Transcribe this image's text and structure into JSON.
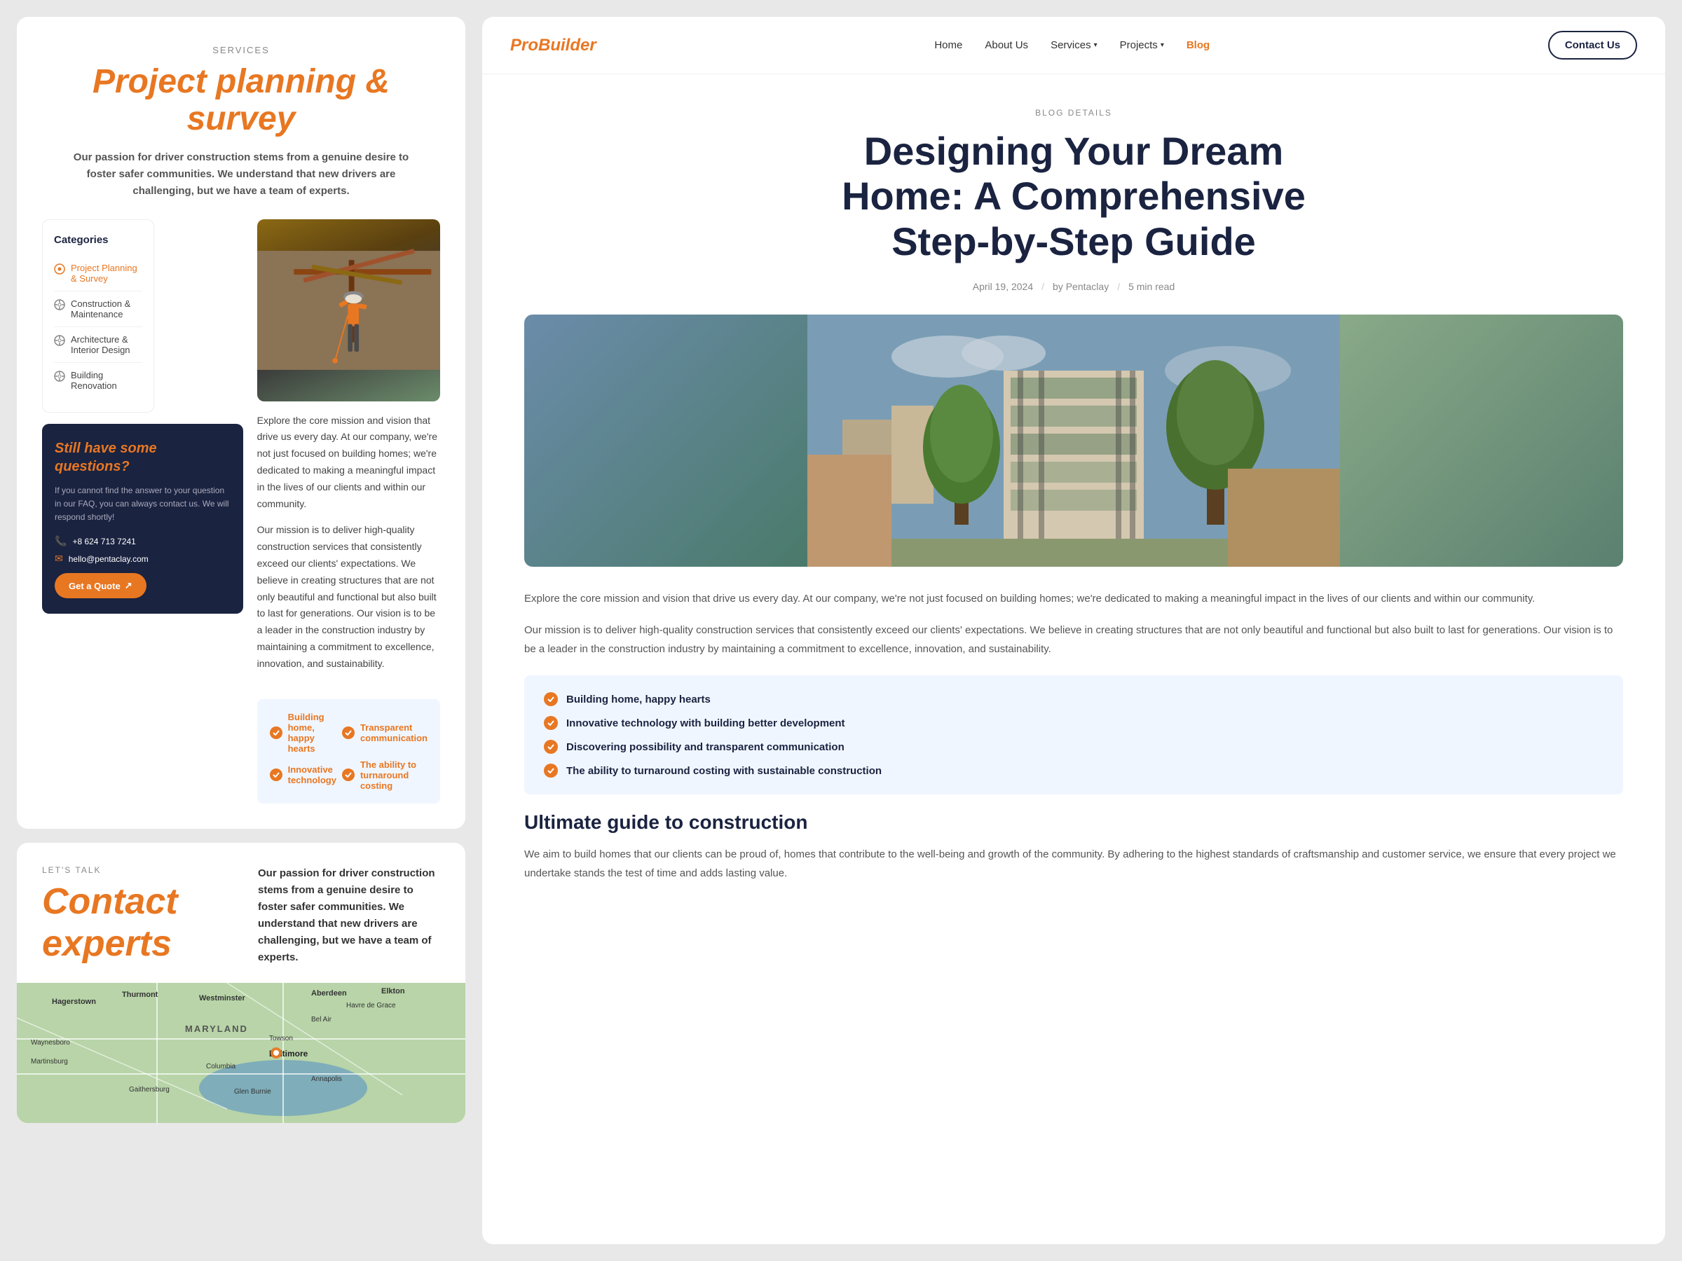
{
  "left": {
    "services_label": "SERVICES",
    "services_title_prefix": "Project ",
    "services_title_italic": "planning",
    "services_title_suffix": " & survey",
    "services_subtitle": "Our passion for driver construction stems from a genuine desire to foster safer communities.  We understand that new drivers are challenging, but we have a team of experts.",
    "categories_title": "Categories",
    "categories": [
      {
        "id": 1,
        "label": "Project Planning & Survey",
        "active": true
      },
      {
        "id": 2,
        "label": "Construction & Maintenance",
        "active": false
      },
      {
        "id": 3,
        "label": "Architecture & Interior Design",
        "active": false
      },
      {
        "id": 4,
        "label": "Building Renovation",
        "active": false
      }
    ],
    "questions_heading": "Still have some",
    "questions_italic": "questions?",
    "questions_body": "If you cannot find the answer to your question in our FAQ, you can always contact us. We will respond shortly!",
    "phone": "+8 624 713 7241",
    "email": "hello@pentaclay.com",
    "quote_btn": "Get a Quote",
    "content_p1": "Explore the core mission and vision that drive us every day. At our company, we're not just focused on building homes; we're dedicated to making a meaningful impact in the lives of our clients and within our community.",
    "content_p2": "Our mission is to deliver high-quality construction services that consistently exceed our clients' expectations. We believe in creating structures that are not only beautiful and functional but also built to last for generations. Our vision is to be a leader in the construction industry by maintaining a commitment to excellence, innovation, and sustainability.",
    "features": [
      {
        "label": "Building home, happy hearts"
      },
      {
        "label": "Transparent communication"
      },
      {
        "label": "Innovative technology"
      },
      {
        "label": "The ability to turnaround costing"
      }
    ]
  },
  "contact": {
    "lets_talk": "LET'S TALK",
    "title_prefix": "Contact ",
    "title_italic": "experts",
    "description": "Our passion for driver construction stems from a genuine desire to foster safer communities.  We understand that new drivers are challenging, but we have a team of experts.",
    "map_labels": [
      {
        "text": "Hagerstown",
        "top": "22%",
        "left": "8%"
      },
      {
        "text": "Thurmont",
        "top": "15%",
        "left": "20%"
      },
      {
        "text": "Westminster",
        "top": "18%",
        "left": "38%"
      },
      {
        "text": "Aberdeen",
        "top": "12%",
        "left": "58%"
      },
      {
        "text": "Elkton",
        "top": "10%",
        "left": "74%"
      },
      {
        "text": "MARYLAND",
        "top": "35%",
        "left": "40%"
      },
      {
        "text": "Baltimore",
        "top": "52%",
        "left": "52%"
      },
      {
        "text": "Bel Air",
        "top": "28%",
        "left": "62%"
      },
      {
        "text": "Havre de Grace",
        "top": "18%",
        "left": "70%"
      },
      {
        "text": "Annapolis",
        "top": "68%",
        "left": "62%"
      },
      {
        "text": "Towson",
        "top": "42%",
        "left": "55%"
      },
      {
        "text": "Gaithersburg",
        "top": "70%",
        "left": "25%"
      },
      {
        "text": "Glen Burnie",
        "top": "68%",
        "left": "50%"
      },
      {
        "text": "Martinsburg",
        "top": "55%",
        "left": "5%"
      },
      {
        "text": "Waynesboro",
        "top": "42%",
        "left": "4%"
      },
      {
        "text": "Columbia",
        "top": "60%",
        "left": "42%"
      },
      {
        "text": "Bel Air",
        "top": "36%",
        "left": "62%"
      },
      {
        "text": "Aberdeen",
        "top": "20%",
        "left": "68%"
      }
    ]
  },
  "right": {
    "logo_italic": "Pro",
    "logo_bold": "Builder",
    "nav": {
      "links": [
        {
          "label": "Home",
          "active": false,
          "has_arrow": false
        },
        {
          "label": "About Us",
          "active": false,
          "has_arrow": false
        },
        {
          "label": "Services",
          "active": false,
          "has_arrow": true
        },
        {
          "label": "Projects",
          "active": false,
          "has_arrow": true
        },
        {
          "label": "Blog",
          "active": true,
          "has_arrow": false
        }
      ],
      "contact_btn": "Contact Us"
    },
    "blog": {
      "details_label": "BLOG DETAILS",
      "title": "Designing Your Dream Home: A Comprehensive Step-by-Step Guide",
      "meta": {
        "date": "April 19, 2024",
        "author": "by Pentaclay",
        "read_time": "5 min read"
      },
      "p1": "Explore the core mission and vision that drive us every day. At our company, we're not just focused on building homes; we're dedicated to making a meaningful impact in the lives of our clients and within our community.",
      "p2": "Our mission is to deliver high-quality construction services that consistently exceed our clients' expectations. We believe in creating structures that are not only beautiful and functional but also built to last for generations. Our vision is to be a leader in the construction industry by maintaining a commitment to excellence, innovation, and sustainability.",
      "features": [
        {
          "label": "Building home, happy hearts"
        },
        {
          "label": "Innovative technology with building better development"
        },
        {
          "label": "Discovering possibility and transparent communication"
        },
        {
          "label": "The ability to turnaround costing with sustainable construction"
        }
      ],
      "section_title": "Ultimate guide to construction",
      "section_p": "We aim to build homes that our clients can be proud of, homes that contribute to the well-being and growth of the community. By adhering to the highest standards of craftsmanship and customer service, we ensure that every project we undertake stands the test of time and adds lasting value."
    }
  }
}
